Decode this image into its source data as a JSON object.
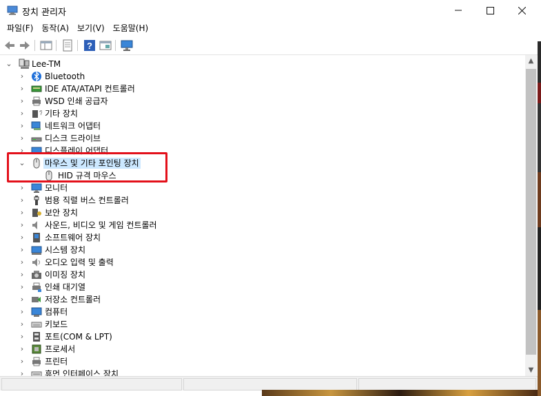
{
  "window": {
    "title": "장치 관리자"
  },
  "menu": [
    "파일(F)",
    "동작(A)",
    "보기(V)",
    "도움말(H)"
  ],
  "tree": {
    "root": "Lee-TM",
    "categories": [
      {
        "label": "Bluetooth",
        "icon": "bluetooth-icon",
        "expanded": false
      },
      {
        "label": "IDE ATA/ATAPI 컨트롤러",
        "icon": "ide-controller-icon",
        "expanded": false
      },
      {
        "label": "WSD 인쇄 공급자",
        "icon": "wsd-printer-icon",
        "expanded": false
      },
      {
        "label": "기타 장치",
        "icon": "unknown-device-icon",
        "expanded": false
      },
      {
        "label": "네트워크 어댑터",
        "icon": "network-adapter-icon",
        "expanded": false
      },
      {
        "label": "디스크 드라이브",
        "icon": "disk-drive-icon",
        "expanded": false
      },
      {
        "label": "디스플레이 어댑터",
        "icon": "display-adapter-icon",
        "expanded": false
      },
      {
        "label": "마우스 및 기타 포인팅 장치",
        "icon": "mouse-icon",
        "expanded": true,
        "selected": true,
        "children": [
          "HID 규격 마우스"
        ]
      },
      {
        "label": "모니터",
        "icon": "monitor-icon",
        "expanded": false
      },
      {
        "label": "범용 직렬 버스 컨트롤러",
        "icon": "usb-controller-icon",
        "expanded": false
      },
      {
        "label": "보안 장치",
        "icon": "security-device-icon",
        "expanded": false
      },
      {
        "label": "사운드, 비디오 및 게임 컨트롤러",
        "icon": "sound-controller-icon",
        "expanded": false
      },
      {
        "label": "소프트웨어 장치",
        "icon": "software-device-icon",
        "expanded": false
      },
      {
        "label": "시스템 장치",
        "icon": "system-device-icon",
        "expanded": false
      },
      {
        "label": "오디오 입력 및 출력",
        "icon": "audio-io-icon",
        "expanded": false
      },
      {
        "label": "이미징 장치",
        "icon": "imaging-device-icon",
        "expanded": false
      },
      {
        "label": "인쇄 대기열",
        "icon": "print-queue-icon",
        "expanded": false
      },
      {
        "label": "저장소 컨트롤러",
        "icon": "storage-controller-icon",
        "expanded": false
      },
      {
        "label": "컴퓨터",
        "icon": "computer-icon",
        "expanded": false
      },
      {
        "label": "키보드",
        "icon": "keyboard-icon",
        "expanded": false
      },
      {
        "label": "포트(COM & LPT)",
        "icon": "port-icon",
        "expanded": false
      },
      {
        "label": "프로세서",
        "icon": "processor-icon",
        "expanded": false
      },
      {
        "label": "프린터",
        "icon": "printer-icon",
        "expanded": false
      },
      {
        "label": "휴먼 인터페이스 장치",
        "icon": "hid-icon",
        "expanded": false
      }
    ]
  },
  "colors": {
    "highlight_border": "#e3101a",
    "selection": "#cce8ff"
  }
}
